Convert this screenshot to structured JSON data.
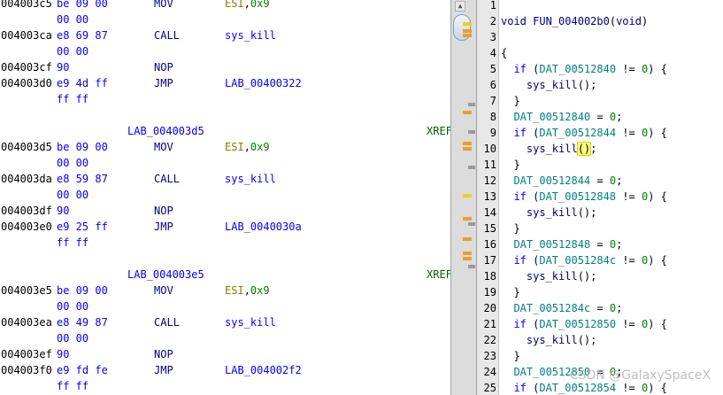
{
  "listing": {
    "rows": [
      {
        "addr": "004003c5",
        "bytes": "be 09 00",
        "mnemonic": "MOV",
        "operand": "ESI,0x9",
        "operand_type": "reg"
      },
      {
        "addr": "",
        "bytes": "00 00",
        "mnemonic": "",
        "operand": "",
        "operand_type": ""
      },
      {
        "addr": "004003ca",
        "bytes": "e8 69 87",
        "mnemonic": "CALL",
        "operand": "sys_kill",
        "operand_type": "ref"
      },
      {
        "addr": "",
        "bytes": "00 00",
        "mnemonic": "",
        "operand": "",
        "operand_type": ""
      },
      {
        "addr": "004003cf",
        "bytes": "90",
        "mnemonic": "NOP",
        "operand": "",
        "operand_type": ""
      },
      {
        "addr": "004003d0",
        "bytes": "e9 4d ff",
        "mnemonic": "JMP",
        "operand": "LAB_00400322",
        "operand_type": "ref"
      },
      {
        "addr": "",
        "bytes": "ff ff",
        "mnemonic": "",
        "operand": "",
        "operand_type": ""
      },
      {
        "addr": "",
        "bytes": "",
        "mnemonic": "",
        "operand": "",
        "operand_type": ""
      },
      {
        "label": "LAB_004003d5",
        "xref": "XREF"
      },
      {
        "addr": "004003d5",
        "bytes": "be 09 00",
        "mnemonic": "MOV",
        "operand": "ESI,0x9",
        "operand_type": "reg"
      },
      {
        "addr": "",
        "bytes": "00 00",
        "mnemonic": "",
        "operand": "",
        "operand_type": ""
      },
      {
        "addr": "004003da",
        "bytes": "e8 59 87",
        "mnemonic": "CALL",
        "operand": "sys_kill",
        "operand_type": "ref"
      },
      {
        "addr": "",
        "bytes": "00 00",
        "mnemonic": "",
        "operand": "",
        "operand_type": ""
      },
      {
        "addr": "004003df",
        "bytes": "90",
        "mnemonic": "NOP",
        "operand": "",
        "operand_type": ""
      },
      {
        "addr": "004003e0",
        "bytes": "e9 25 ff",
        "mnemonic": "JMP",
        "operand": "LAB_0040030a",
        "operand_type": "ref"
      },
      {
        "addr": "",
        "bytes": "ff ff",
        "mnemonic": "",
        "operand": "",
        "operand_type": ""
      },
      {
        "addr": "",
        "bytes": "",
        "mnemonic": "",
        "operand": "",
        "operand_type": ""
      },
      {
        "label": "LAB_004003e5",
        "xref": "XREF"
      },
      {
        "addr": "004003e5",
        "bytes": "be 09 00",
        "mnemonic": "MOV",
        "operand": "ESI,0x9",
        "operand_type": "reg"
      },
      {
        "addr": "",
        "bytes": "00 00",
        "mnemonic": "",
        "operand": "",
        "operand_type": ""
      },
      {
        "addr": "004003ea",
        "bytes": "e8 49 87",
        "mnemonic": "CALL",
        "operand": "sys_kill",
        "operand_type": "ref"
      },
      {
        "addr": "",
        "bytes": "00 00",
        "mnemonic": "",
        "operand": "",
        "operand_type": ""
      },
      {
        "addr": "004003ef",
        "bytes": "90",
        "mnemonic": "NOP",
        "operand": "",
        "operand_type": ""
      },
      {
        "addr": "004003f0",
        "bytes": "e9 fd fe",
        "mnemonic": "JMP",
        "operand": "LAB_004002f2",
        "operand_type": "ref"
      },
      {
        "addr": "",
        "bytes": "ff ff",
        "mnemonic": "",
        "operand": "",
        "operand_type": ""
      }
    ]
  },
  "overview_markers": [
    {
      "kind": "yellow"
    },
    {
      "kind": "orange"
    },
    {
      "kind": "orange"
    },
    {
      "kind": "gray"
    },
    {
      "kind": "orange"
    },
    {
      "kind": "gray"
    },
    {
      "kind": "orange"
    },
    {
      "kind": "orange"
    },
    {
      "kind": "gray"
    },
    {
      "kind": "yellow"
    },
    {
      "kind": "orange"
    },
    {
      "kind": "gray"
    },
    {
      "kind": "orange"
    },
    {
      "kind": "orange"
    },
    {
      "kind": "orange"
    },
    {
      "kind": "gray"
    }
  ],
  "decompiler": {
    "lines": [
      {
        "num": "1",
        "tokens": []
      },
      {
        "num": "2",
        "tokens": [
          {
            "t": "void",
            "c": "k-type"
          },
          {
            "t": " ",
            "c": ""
          },
          {
            "t": "FUN_004002b0",
            "c": "k-func"
          },
          {
            "t": "(",
            "c": "k-punct"
          },
          {
            "t": "void",
            "c": "k-type"
          },
          {
            "t": ")",
            "c": "k-punct"
          }
        ]
      },
      {
        "num": "3",
        "tokens": []
      },
      {
        "num": "4",
        "tokens": [
          {
            "t": "{",
            "c": "k-punct"
          }
        ]
      },
      {
        "num": "5",
        "tokens": [
          {
            "t": "  ",
            "c": ""
          },
          {
            "t": "if",
            "c": "k-kw"
          },
          {
            "t": " (",
            "c": "k-punct"
          },
          {
            "t": "DAT_00512840",
            "c": "k-var"
          },
          {
            "t": " != ",
            "c": "k-punct"
          },
          {
            "t": "0",
            "c": "k-num"
          },
          {
            "t": ") {",
            "c": "k-punct"
          }
        ]
      },
      {
        "num": "6",
        "tokens": [
          {
            "t": "    ",
            "c": ""
          },
          {
            "t": "sys_kill",
            "c": "k-func"
          },
          {
            "t": "();",
            "c": "k-punct"
          }
        ]
      },
      {
        "num": "7",
        "tokens": [
          {
            "t": "  }",
            "c": "k-punct"
          }
        ]
      },
      {
        "num": "8",
        "tokens": [
          {
            "t": "  ",
            "c": ""
          },
          {
            "t": "DAT_00512840",
            "c": "k-var"
          },
          {
            "t": " = ",
            "c": "k-punct"
          },
          {
            "t": "0",
            "c": "k-num"
          },
          {
            "t": ";",
            "c": "k-punct"
          }
        ]
      },
      {
        "num": "9",
        "tokens": [
          {
            "t": "  ",
            "c": ""
          },
          {
            "t": "if",
            "c": "k-kw"
          },
          {
            "t": " (",
            "c": "k-punct"
          },
          {
            "t": "DAT_00512844",
            "c": "k-var"
          },
          {
            "t": " != ",
            "c": "k-punct"
          },
          {
            "t": "0",
            "c": "k-num"
          },
          {
            "t": ") {",
            "c": "k-punct"
          }
        ]
      },
      {
        "num": "10",
        "tokens": [
          {
            "t": "    ",
            "c": ""
          },
          {
            "t": "sys_kill",
            "c": "k-func"
          },
          {
            "t": "CURSOR",
            "c": "caret"
          },
          {
            "t": "()",
            "c": "cursor-hl"
          },
          {
            "t": ";",
            "c": "k-punct"
          }
        ]
      },
      {
        "num": "11",
        "tokens": [
          {
            "t": "  }",
            "c": "k-punct"
          }
        ]
      },
      {
        "num": "12",
        "tokens": [
          {
            "t": "  ",
            "c": ""
          },
          {
            "t": "DAT_00512844",
            "c": "k-var"
          },
          {
            "t": " = ",
            "c": "k-punct"
          },
          {
            "t": "0",
            "c": "k-num"
          },
          {
            "t": ";",
            "c": "k-punct"
          }
        ]
      },
      {
        "num": "13",
        "tokens": [
          {
            "t": "  ",
            "c": ""
          },
          {
            "t": "if",
            "c": "k-kw"
          },
          {
            "t": " (",
            "c": "k-punct"
          },
          {
            "t": "DAT_00512848",
            "c": "k-var"
          },
          {
            "t": " != ",
            "c": "k-punct"
          },
          {
            "t": "0",
            "c": "k-num"
          },
          {
            "t": ") {",
            "c": "k-punct"
          }
        ]
      },
      {
        "num": "14",
        "tokens": [
          {
            "t": "    ",
            "c": ""
          },
          {
            "t": "sys_kill",
            "c": "k-func"
          },
          {
            "t": "();",
            "c": "k-punct"
          }
        ]
      },
      {
        "num": "15",
        "tokens": [
          {
            "t": "  }",
            "c": "k-punct"
          }
        ]
      },
      {
        "num": "16",
        "tokens": [
          {
            "t": "  ",
            "c": ""
          },
          {
            "t": "DAT_00512848",
            "c": "k-var"
          },
          {
            "t": " = ",
            "c": "k-punct"
          },
          {
            "t": "0",
            "c": "k-num"
          },
          {
            "t": ";",
            "c": "k-punct"
          }
        ]
      },
      {
        "num": "17",
        "tokens": [
          {
            "t": "  ",
            "c": ""
          },
          {
            "t": "if",
            "c": "k-kw"
          },
          {
            "t": " (",
            "c": "k-punct"
          },
          {
            "t": "DAT_0051284c",
            "c": "k-var"
          },
          {
            "t": " != ",
            "c": "k-punct"
          },
          {
            "t": "0",
            "c": "k-num"
          },
          {
            "t": ") {",
            "c": "k-punct"
          }
        ]
      },
      {
        "num": "18",
        "tokens": [
          {
            "t": "    ",
            "c": ""
          },
          {
            "t": "sys_kill",
            "c": "k-func"
          },
          {
            "t": "();",
            "c": "k-punct"
          }
        ]
      },
      {
        "num": "19",
        "tokens": [
          {
            "t": "  }",
            "c": "k-punct"
          }
        ]
      },
      {
        "num": "20",
        "tokens": [
          {
            "t": "  ",
            "c": ""
          },
          {
            "t": "DAT_0051284c",
            "c": "k-var"
          },
          {
            "t": " = ",
            "c": "k-punct"
          },
          {
            "t": "0",
            "c": "k-num"
          },
          {
            "t": ";",
            "c": "k-punct"
          }
        ]
      },
      {
        "num": "21",
        "tokens": [
          {
            "t": "  ",
            "c": ""
          },
          {
            "t": "if",
            "c": "k-kw"
          },
          {
            "t": " (",
            "c": "k-punct"
          },
          {
            "t": "DAT_00512850",
            "c": "k-var"
          },
          {
            "t": " != ",
            "c": "k-punct"
          },
          {
            "t": "0",
            "c": "k-num"
          },
          {
            "t": ") {",
            "c": "k-punct"
          }
        ]
      },
      {
        "num": "22",
        "tokens": [
          {
            "t": "    ",
            "c": ""
          },
          {
            "t": "sys_kill",
            "c": "k-func"
          },
          {
            "t": "();",
            "c": "k-punct"
          }
        ]
      },
      {
        "num": "23",
        "tokens": [
          {
            "t": "  }",
            "c": "k-punct"
          }
        ]
      },
      {
        "num": "24",
        "tokens": [
          {
            "t": "  ",
            "c": ""
          },
          {
            "t": "DAT_00512850",
            "c": "k-var"
          },
          {
            "t": " = ",
            "c": "k-punct"
          },
          {
            "t": "0",
            "c": "k-num"
          },
          {
            "t": ";",
            "c": "k-punct"
          }
        ]
      },
      {
        "num": "25",
        "tokens": [
          {
            "t": "  ",
            "c": ""
          },
          {
            "t": "if",
            "c": "k-kw"
          },
          {
            "t": " (",
            "c": "k-punct"
          },
          {
            "t": "DAT_00512854",
            "c": "k-var"
          },
          {
            "t": " != ",
            "c": "k-punct"
          },
          {
            "t": "0",
            "c": "k-num"
          },
          {
            "t": ") {",
            "c": "k-punct"
          }
        ]
      }
    ]
  },
  "watermark": "CSDN @GalaxySpaceX"
}
